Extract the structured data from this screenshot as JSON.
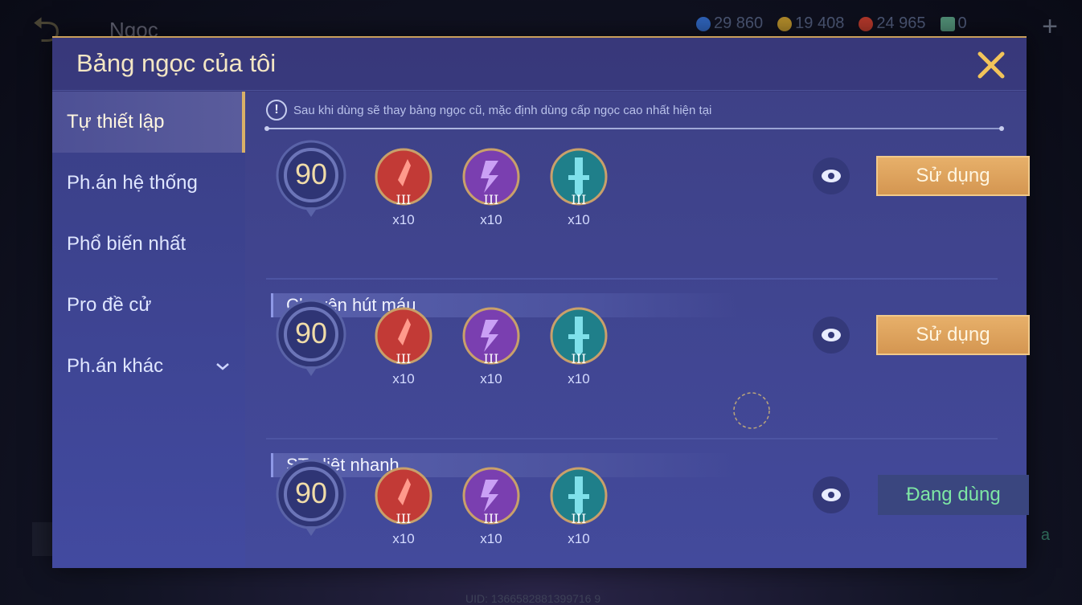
{
  "background": {
    "title": "Ngọc",
    "currencies": [
      {
        "icon": "blue-coin-icon",
        "value": "29 860",
        "color": "#2e62b8"
      },
      {
        "icon": "gold-coin-icon",
        "value": "19 408",
        "color": "#b08a2a"
      },
      {
        "icon": "red-gem-icon",
        "value": "24 965",
        "color": "#b0372a"
      },
      {
        "icon": "ticket-icon",
        "value": "0",
        "color": "#4f8c74"
      }
    ],
    "plus": "+",
    "uid": "UID: 1366582881399716 9",
    "right_hint": "a"
  },
  "modal": {
    "title": "Bảng ngọc của tôi",
    "close_icon": "close-icon"
  },
  "sidebar": {
    "items": [
      {
        "label": "Tự thiết lập"
      },
      {
        "label": "Ph.án hệ thống"
      },
      {
        "label": "Phổ biến nhất"
      },
      {
        "label": "Pro đề cử"
      },
      {
        "label": "Ph.án khác"
      }
    ]
  },
  "notice": {
    "icon": "!",
    "text": "Sau khi dùng sẽ thay bảng ngọc cũ, mặc định dùng cấp ngọc cao nhất hiện tại"
  },
  "sets": [
    {
      "title": "",
      "level": "90",
      "gems": [
        {
          "tier": "III",
          "count": "x10",
          "color": "#c23a36"
        },
        {
          "tier": "III",
          "count": "x10",
          "color": "#7a3fb0"
        },
        {
          "tier": "III",
          "count": "x10",
          "color": "#1f7f8a"
        }
      ],
      "button": "Sử dụng",
      "in_use": false
    },
    {
      "title": "Chuyên hút máu",
      "level": "90",
      "gems": [
        {
          "tier": "III",
          "count": "x10",
          "color": "#c23a36"
        },
        {
          "tier": "III",
          "count": "x10",
          "color": "#7a3fb0"
        },
        {
          "tier": "III",
          "count": "x10",
          "color": "#1f7f8a"
        }
      ],
      "button": "Sử dụng",
      "in_use": false
    },
    {
      "title": "ST, diệt nhanh",
      "level": "90",
      "gems": [
        {
          "tier": "III",
          "count": "x10",
          "color": "#c23a36"
        },
        {
          "tier": "III",
          "count": "x10",
          "color": "#7a3fb0"
        },
        {
          "tier": "III",
          "count": "x10",
          "color": "#1f7f8a"
        }
      ],
      "button": "Đang dùng",
      "in_use": true
    }
  ]
}
